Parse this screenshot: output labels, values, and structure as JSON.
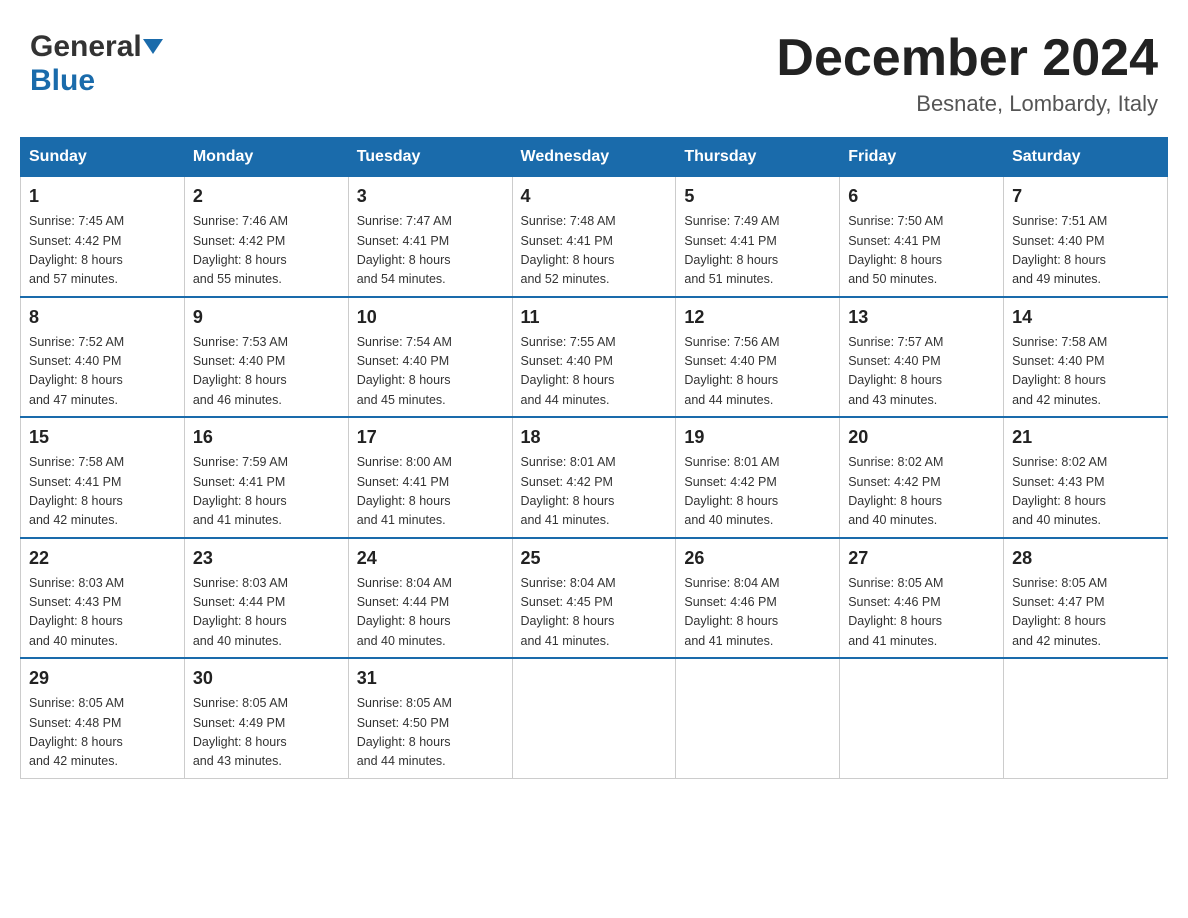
{
  "header": {
    "logo_general": "General",
    "logo_blue": "Blue",
    "month_title": "December 2024",
    "location": "Besnate, Lombardy, Italy"
  },
  "weekdays": [
    "Sunday",
    "Monday",
    "Tuesday",
    "Wednesday",
    "Thursday",
    "Friday",
    "Saturday"
  ],
  "weeks": [
    [
      {
        "day": "1",
        "sunrise": "7:45 AM",
        "sunset": "4:42 PM",
        "daylight": "8 hours and 57 minutes."
      },
      {
        "day": "2",
        "sunrise": "7:46 AM",
        "sunset": "4:42 PM",
        "daylight": "8 hours and 55 minutes."
      },
      {
        "day": "3",
        "sunrise": "7:47 AM",
        "sunset": "4:41 PM",
        "daylight": "8 hours and 54 minutes."
      },
      {
        "day": "4",
        "sunrise": "7:48 AM",
        "sunset": "4:41 PM",
        "daylight": "8 hours and 52 minutes."
      },
      {
        "day": "5",
        "sunrise": "7:49 AM",
        "sunset": "4:41 PM",
        "daylight": "8 hours and 51 minutes."
      },
      {
        "day": "6",
        "sunrise": "7:50 AM",
        "sunset": "4:41 PM",
        "daylight": "8 hours and 50 minutes."
      },
      {
        "day": "7",
        "sunrise": "7:51 AM",
        "sunset": "4:40 PM",
        "daylight": "8 hours and 49 minutes."
      }
    ],
    [
      {
        "day": "8",
        "sunrise": "7:52 AM",
        "sunset": "4:40 PM",
        "daylight": "8 hours and 47 minutes."
      },
      {
        "day": "9",
        "sunrise": "7:53 AM",
        "sunset": "4:40 PM",
        "daylight": "8 hours and 46 minutes."
      },
      {
        "day": "10",
        "sunrise": "7:54 AM",
        "sunset": "4:40 PM",
        "daylight": "8 hours and 45 minutes."
      },
      {
        "day": "11",
        "sunrise": "7:55 AM",
        "sunset": "4:40 PM",
        "daylight": "8 hours and 44 minutes."
      },
      {
        "day": "12",
        "sunrise": "7:56 AM",
        "sunset": "4:40 PM",
        "daylight": "8 hours and 44 minutes."
      },
      {
        "day": "13",
        "sunrise": "7:57 AM",
        "sunset": "4:40 PM",
        "daylight": "8 hours and 43 minutes."
      },
      {
        "day": "14",
        "sunrise": "7:58 AM",
        "sunset": "4:40 PM",
        "daylight": "8 hours and 42 minutes."
      }
    ],
    [
      {
        "day": "15",
        "sunrise": "7:58 AM",
        "sunset": "4:41 PM",
        "daylight": "8 hours and 42 minutes."
      },
      {
        "day": "16",
        "sunrise": "7:59 AM",
        "sunset": "4:41 PM",
        "daylight": "8 hours and 41 minutes."
      },
      {
        "day": "17",
        "sunrise": "8:00 AM",
        "sunset": "4:41 PM",
        "daylight": "8 hours and 41 minutes."
      },
      {
        "day": "18",
        "sunrise": "8:01 AM",
        "sunset": "4:42 PM",
        "daylight": "8 hours and 41 minutes."
      },
      {
        "day": "19",
        "sunrise": "8:01 AM",
        "sunset": "4:42 PM",
        "daylight": "8 hours and 40 minutes."
      },
      {
        "day": "20",
        "sunrise": "8:02 AM",
        "sunset": "4:42 PM",
        "daylight": "8 hours and 40 minutes."
      },
      {
        "day": "21",
        "sunrise": "8:02 AM",
        "sunset": "4:43 PM",
        "daylight": "8 hours and 40 minutes."
      }
    ],
    [
      {
        "day": "22",
        "sunrise": "8:03 AM",
        "sunset": "4:43 PM",
        "daylight": "8 hours and 40 minutes."
      },
      {
        "day": "23",
        "sunrise": "8:03 AM",
        "sunset": "4:44 PM",
        "daylight": "8 hours and 40 minutes."
      },
      {
        "day": "24",
        "sunrise": "8:04 AM",
        "sunset": "4:44 PM",
        "daylight": "8 hours and 40 minutes."
      },
      {
        "day": "25",
        "sunrise": "8:04 AM",
        "sunset": "4:45 PM",
        "daylight": "8 hours and 41 minutes."
      },
      {
        "day": "26",
        "sunrise": "8:04 AM",
        "sunset": "4:46 PM",
        "daylight": "8 hours and 41 minutes."
      },
      {
        "day": "27",
        "sunrise": "8:05 AM",
        "sunset": "4:46 PM",
        "daylight": "8 hours and 41 minutes."
      },
      {
        "day": "28",
        "sunrise": "8:05 AM",
        "sunset": "4:47 PM",
        "daylight": "8 hours and 42 minutes."
      }
    ],
    [
      {
        "day": "29",
        "sunrise": "8:05 AM",
        "sunset": "4:48 PM",
        "daylight": "8 hours and 42 minutes."
      },
      {
        "day": "30",
        "sunrise": "8:05 AM",
        "sunset": "4:49 PM",
        "daylight": "8 hours and 43 minutes."
      },
      {
        "day": "31",
        "sunrise": "8:05 AM",
        "sunset": "4:50 PM",
        "daylight": "8 hours and 44 minutes."
      },
      null,
      null,
      null,
      null
    ]
  ],
  "labels": {
    "sunrise": "Sunrise:",
    "sunset": "Sunset:",
    "daylight": "Daylight:"
  }
}
